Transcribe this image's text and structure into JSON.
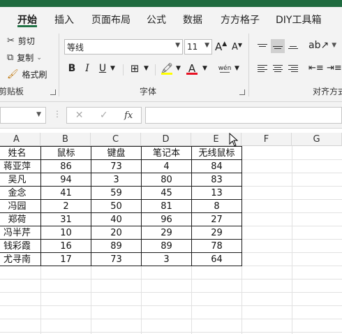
{
  "tabs": [
    {
      "label": "开始",
      "active": true
    },
    {
      "label": "插入"
    },
    {
      "label": "页面布局"
    },
    {
      "label": "公式"
    },
    {
      "label": "数据"
    },
    {
      "label": "方方格子"
    },
    {
      "label": "DIY工具箱"
    }
  ],
  "clipboard": {
    "cut": "剪切",
    "copy": "复制",
    "format_painter": "格式刷",
    "group_label": "剪贴板"
  },
  "font": {
    "name": "等线",
    "size": "11",
    "group_label": "字体",
    "bold": "B",
    "italic": "I",
    "underline": "U",
    "font_color_glyph": "A",
    "phonetic_glyph": "wén",
    "grow_glyph": "A",
    "shrink_glyph": "A",
    "highlight_color": "#ffff00",
    "font_color": "#e81123"
  },
  "alignment": {
    "group_label": "对齐方式"
  },
  "formula_bar": {
    "fx": "fx",
    "cancel": "✕",
    "confirm": "✓"
  },
  "columns": [
    "A",
    "B",
    "C",
    "D",
    "E",
    "F",
    "G"
  ],
  "table": {
    "headers": [
      "姓名",
      "鼠标",
      "键盘",
      "笔记本",
      "无线鼠标"
    ],
    "rows": [
      [
        "蒋亚萍",
        "86",
        "73",
        "4",
        "84"
      ],
      [
        "吴凡",
        "94",
        "3",
        "80",
        "83"
      ],
      [
        "金念",
        "41",
        "59",
        "45",
        "13"
      ],
      [
        "冯园",
        "2",
        "50",
        "81",
        "8"
      ],
      [
        "郑荷",
        "31",
        "40",
        "96",
        "27"
      ],
      [
        "冯半芹",
        "10",
        "20",
        "29",
        "29"
      ],
      [
        "钱彩霞",
        "16",
        "89",
        "89",
        "78"
      ],
      [
        "尤寻南",
        "17",
        "73",
        "3",
        "64"
      ]
    ]
  },
  "colors": {
    "accent": "#217346"
  }
}
